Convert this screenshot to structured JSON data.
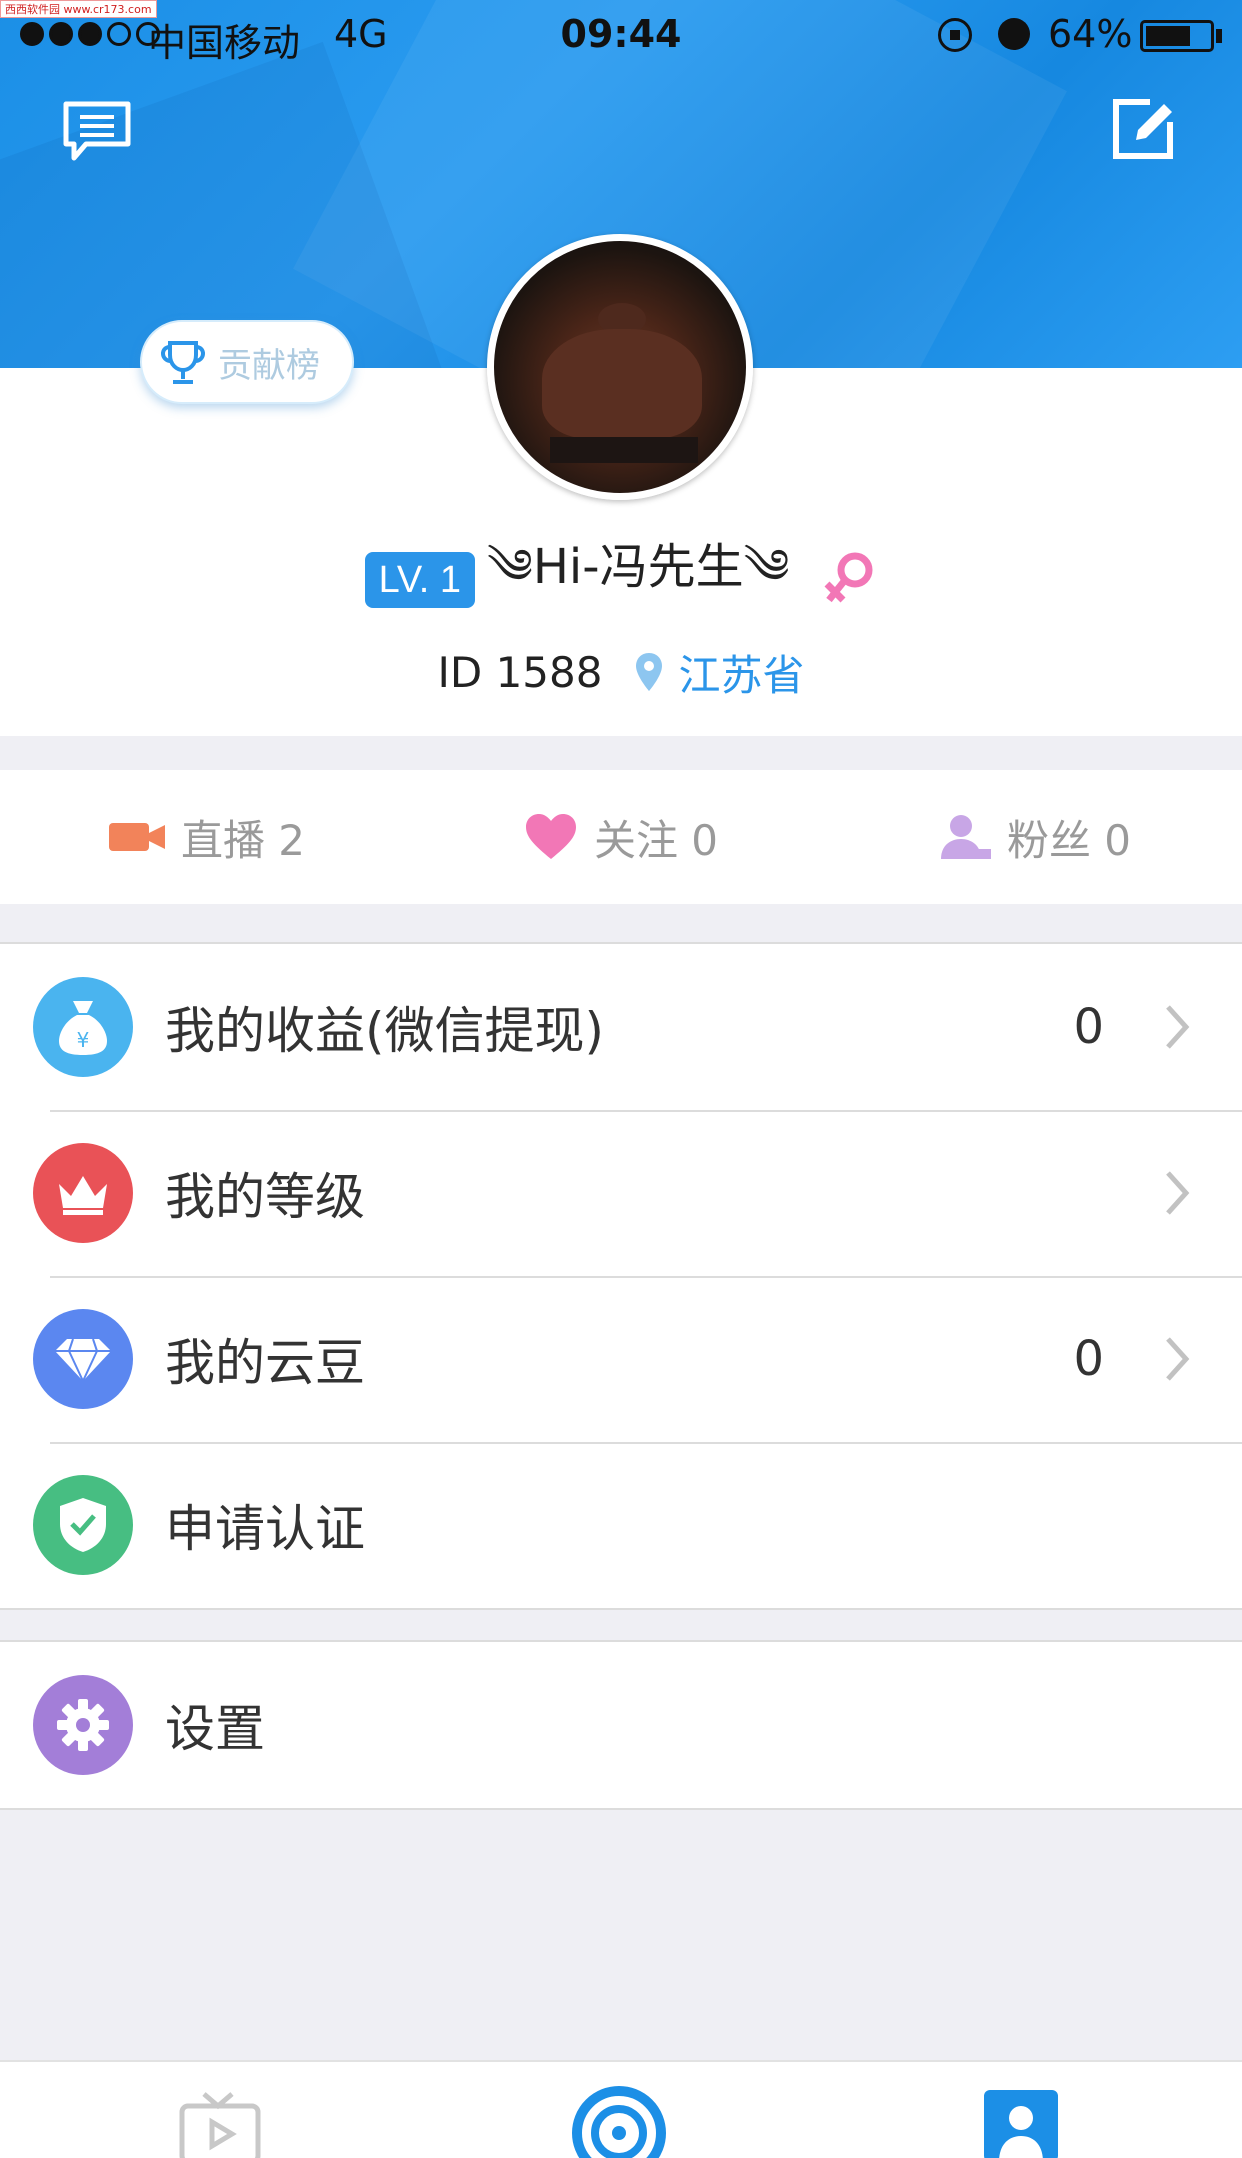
{
  "watermark": "西西软件园 www.cr173.com",
  "status_bar": {
    "carrier": "中国移动",
    "network": "4G",
    "time": "09:44",
    "battery": "64%",
    "battery_level": 0.64
  },
  "header": {
    "message_icon": "message-bubble-icon",
    "edit_icon": "edit-icon"
  },
  "profile": {
    "rank_button_label": "贡献榜",
    "level": "LV. 1",
    "nickname": "༄Hi-冯先生༄",
    "gender": "female",
    "id_text": "ID 1588",
    "location": "江苏省"
  },
  "stats": [
    {
      "label": "直播 2",
      "icon": "video-camera-icon",
      "color": "#f2835a"
    },
    {
      "label": "关注 0",
      "icon": "heart-icon",
      "color": "#f277b6"
    },
    {
      "label": "粉丝 0",
      "icon": "person-icon",
      "color": "#c8a6e6"
    }
  ],
  "menu": [
    {
      "label": "我的收益(微信提现)",
      "value": "0",
      "icon": "money-bag-icon",
      "color": "#4ab4ef",
      "chevron": true
    },
    {
      "label": "我的等级",
      "value": "",
      "icon": "crown-icon",
      "color": "#e95257",
      "chevron": true
    },
    {
      "label": "我的云豆",
      "value": "0",
      "icon": "diamond-icon",
      "color": "#5b87f0",
      "chevron": true
    },
    {
      "label": "申请认证",
      "value": "",
      "icon": "shield-check-icon",
      "color": "#47be82",
      "chevron": false
    }
  ],
  "menu2": [
    {
      "label": "设置",
      "icon": "gear-icon",
      "color": "#a37ed8"
    }
  ],
  "tabbar": {
    "active": "me",
    "colors": {
      "active": "#1c8fe6",
      "inactive": "#c8c8c8"
    }
  }
}
